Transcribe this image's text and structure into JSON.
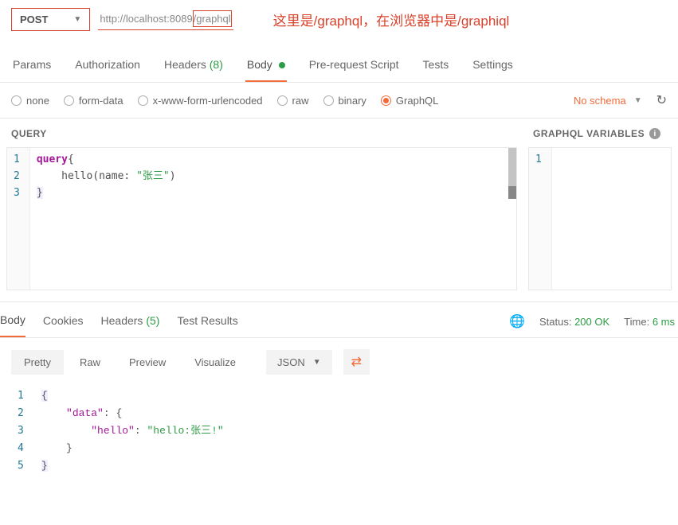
{
  "request": {
    "method": "POST",
    "url_base": "http://localhost:8089",
    "url_path": "/graphql",
    "annotation": "这里是/graphql，在浏览器中是/graphiql"
  },
  "tabs": {
    "params": "Params",
    "authorization": "Authorization",
    "headers": "Headers",
    "headers_count": "(8)",
    "body": "Body",
    "prerequest": "Pre-request Script",
    "tests": "Tests",
    "settings": "Settings"
  },
  "body_types": {
    "none": "none",
    "formdata": "form-data",
    "urlencoded": "x-www-form-urlencoded",
    "raw": "raw",
    "binary": "binary",
    "graphql": "GraphQL",
    "no_schema": "No schema"
  },
  "query_editor": {
    "title": "QUERY",
    "lines": [
      "1",
      "2",
      "3"
    ],
    "code_l1_kw": "query",
    "code_l1_rest": "{",
    "code_l2_indent": "    hello(name: ",
    "code_l2_str": "\"张三\"",
    "code_l2_rest": ")",
    "code_l3": "}"
  },
  "vars_editor": {
    "title": "GRAPHQL VARIABLES",
    "lines": [
      "1"
    ]
  },
  "response_tabs": {
    "body": "Body",
    "cookies": "Cookies",
    "headers": "Headers",
    "headers_count": "(5)",
    "test_results": "Test Results"
  },
  "response_status": {
    "status_label": "Status:",
    "status_value": "200 OK",
    "time_label": "Time:",
    "time_value": "6 ms"
  },
  "response_views": {
    "pretty": "Pretty",
    "raw": "Raw",
    "preview": "Preview",
    "visualize": "Visualize",
    "format": "JSON"
  },
  "response_body": {
    "lines": [
      "1",
      "2",
      "3",
      "4",
      "5"
    ],
    "l1": "{",
    "l2_key": "\"data\"",
    "l2_rest": ": {",
    "l3_key": "\"hello\"",
    "l3_mid": ": ",
    "l3_val": "\"hello:张三!\"",
    "l4": "    }",
    "l5": "}"
  }
}
